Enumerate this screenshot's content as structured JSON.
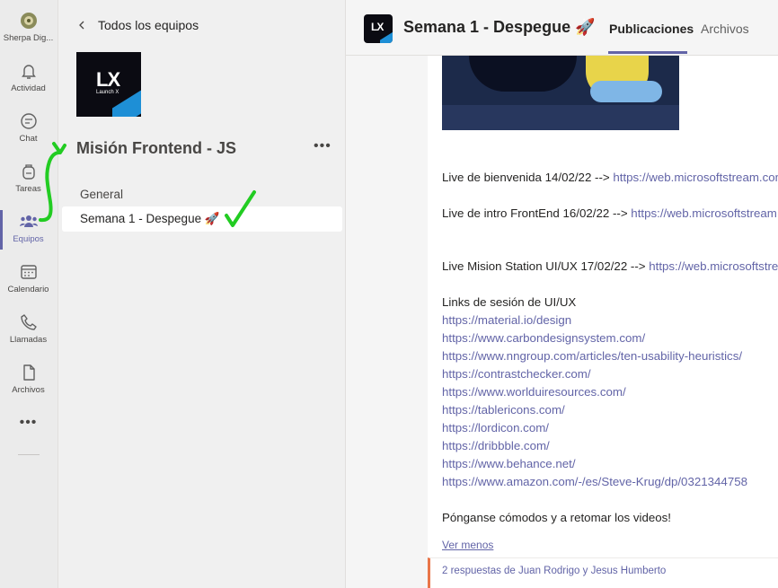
{
  "rail": {
    "items": [
      {
        "label": "Sherpa Dig...",
        "icon": "org-logo-icon"
      },
      {
        "label": "Actividad",
        "icon": "bell-icon"
      },
      {
        "label": "Chat",
        "icon": "chat-icon"
      },
      {
        "label": "Tareas",
        "icon": "backpack-icon"
      },
      {
        "label": "Equipos",
        "icon": "teams-icon",
        "active": true
      },
      {
        "label": "Calendario",
        "icon": "calendar-icon"
      },
      {
        "label": "Llamadas",
        "icon": "phone-icon"
      },
      {
        "label": "Archivos",
        "icon": "file-icon"
      }
    ],
    "more": "•••"
  },
  "team_panel": {
    "back_label": "Todos los equipos",
    "logo_text": "LX",
    "logo_subtext": "Launch X",
    "team_name": "Misión Frontend - JS",
    "more": "•••",
    "channels": [
      {
        "label": "General"
      },
      {
        "label": "Semana 1 - Despegue 🚀",
        "active": true
      }
    ]
  },
  "header": {
    "logo_text": "LX",
    "title": "Semana 1 - Despegue 🚀",
    "tabs": [
      {
        "label": "Publicaciones",
        "active": true
      },
      {
        "label": "Archivos"
      }
    ]
  },
  "post": {
    "lines": [
      {
        "text": "Live de bienvenida 14/02/22 --> ",
        "link": "https://web.microsoftstream.com"
      },
      {
        "text": "Live de intro FrontEnd 16/02/22 --> ",
        "link": "https://web.microsoftstream.com"
      },
      {
        "text": "Live Mision Station UI/UX 17/02/22 --> ",
        "link": "https://web.microsoftstream.com"
      }
    ],
    "links_heading": "Links de sesión de UI/UX",
    "links": [
      "https://material.io/design",
      "https://www.carbondesignsystem.com/",
      "https://www.nngroup.com/articles/ten-usability-heuristics/",
      "https://contrastchecker.com/",
      "https://www.worlduiresources.com/",
      "https://tablericons.com/",
      "https://lordicon.com/",
      "https://dribbble.com/",
      "https://www.behance.net/",
      "https://www.amazon.com/-/es/Steve-Krug/dp/0321344758"
    ],
    "closing": "Pónganse cómodos y a retomar los videos!",
    "see_less": "Ver menos",
    "replies": "2 respuestas de Juan Rodrigo y Jesus Humberto"
  },
  "colors": {
    "accent": "#6264a7",
    "annotation": "#22cc22",
    "reply_bar": "#e97548"
  }
}
